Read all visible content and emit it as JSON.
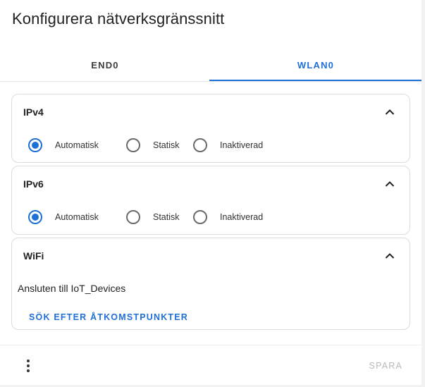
{
  "dialog": {
    "title": "Konfigurera nätverksgränssnitt"
  },
  "tabs": [
    {
      "label": "END0",
      "selected": false
    },
    {
      "label": "WLAN0",
      "selected": true
    }
  ],
  "accent_color": "#1f6fd8",
  "ipv4": {
    "title": "IPv4",
    "expanded": true,
    "options": [
      "Automatisk",
      "Statisk",
      "Inaktiverad"
    ],
    "selected": "Automatisk"
  },
  "ipv6": {
    "title": "IPv6",
    "expanded": true,
    "options": [
      "Automatisk",
      "Statisk",
      "Inaktiverad"
    ],
    "selected": "Automatisk"
  },
  "wifi": {
    "title": "WiFi",
    "expanded": true,
    "status": "Ansluten till IoT_Devices",
    "action_label": "SÖK EFTER ÅTKOMSTPUNKTER"
  },
  "footer": {
    "more_icon": "more-vert-icon",
    "save_label": "SPARA",
    "save_enabled": false
  }
}
